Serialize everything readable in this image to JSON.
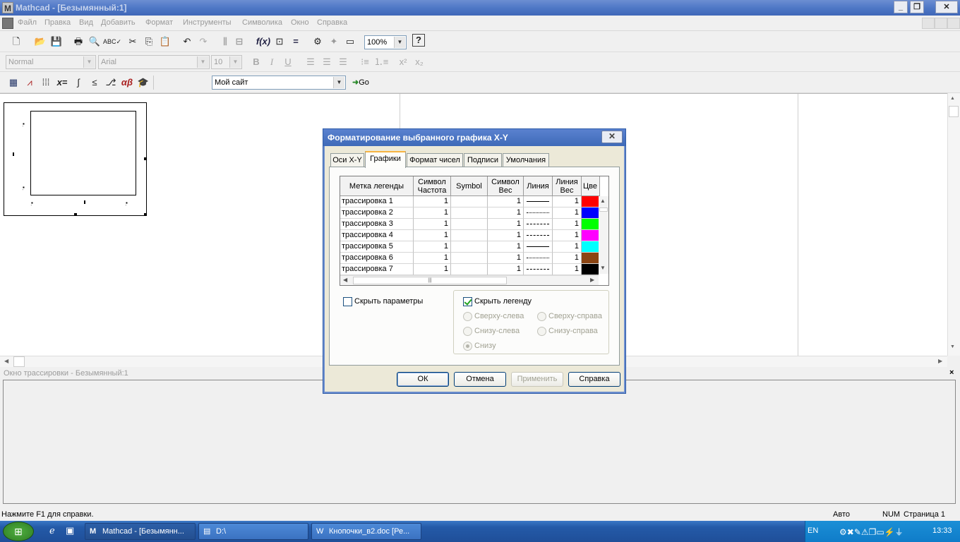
{
  "window": {
    "title": "Mathcad - [Безымянный:1]",
    "app_icon": "mathcad-icon"
  },
  "menu": [
    "Файл",
    "Правка",
    "Вид",
    "Добавить",
    "Формат",
    "Инструменты",
    "Символика",
    "Окно",
    "Справка"
  ],
  "toolbar": {
    "zoom": "100%",
    "style": "Normal",
    "font": "Arial",
    "font_size": "10",
    "site": "Мой сайт",
    "go_label": "Go"
  },
  "formatbar": {
    "bold": "B",
    "italic": "I",
    "underline": "U",
    "superscript": "x²",
    "subscript": "x₂"
  },
  "trace_window": {
    "title": "Окно трассировки - Безымянный:1"
  },
  "status": {
    "hint": "Нажмите F1 для справки.",
    "mode": "Авто",
    "num": "NUM",
    "page": "Страница 1"
  },
  "taskbar": {
    "tasks": [
      "Mathcad - [Безымянн...",
      "D:\\",
      "Кнопочки_в2.doc [Ре..."
    ],
    "lang": "EN",
    "clock": "13:33"
  },
  "dialog": {
    "title": "Форматирование выбранного графика X-Y",
    "tabs": [
      "Оси X-Y",
      "Графики",
      "Формат чисел",
      "Подписи",
      "Умолчания"
    ],
    "selected_tab": "Графики",
    "columns": [
      "Метка легенды",
      "Символ Частота",
      "Symbol",
      "Символ Вес",
      "Линия",
      "Линия Вес",
      "Цве"
    ],
    "rows": [
      {
        "label": "трассировка 1",
        "freq": "1",
        "symbol": "",
        "sym_weight": "1",
        "line": "solid",
        "line_weight": "1",
        "color": "#ff0000"
      },
      {
        "label": "трассировка 2",
        "freq": "1",
        "symbol": "",
        "sym_weight": "1",
        "line": "dotted",
        "line_weight": "1",
        "color": "#0000ff"
      },
      {
        "label": "трассировка 3",
        "freq": "1",
        "symbol": "",
        "sym_weight": "1",
        "line": "dashed",
        "line_weight": "1",
        "color": "#00ff00"
      },
      {
        "label": "трассировка 4",
        "freq": "1",
        "symbol": "",
        "sym_weight": "1",
        "line": "dashdot",
        "line_weight": "1",
        "color": "#ff00ff"
      },
      {
        "label": "трассировка 5",
        "freq": "1",
        "symbol": "",
        "sym_weight": "1",
        "line": "solid",
        "line_weight": "1",
        "color": "#00ffff"
      },
      {
        "label": "трассировка 6",
        "freq": "1",
        "symbol": "",
        "sym_weight": "1",
        "line": "dotted",
        "line_weight": "1",
        "color": "#8b4513"
      },
      {
        "label": "трассировка 7",
        "freq": "1",
        "symbol": "",
        "sym_weight": "1",
        "line": "dashed",
        "line_weight": "1",
        "color": "#000000"
      }
    ],
    "hide_params": {
      "label": "Скрыть параметры",
      "checked": false
    },
    "hide_legend": {
      "label": "Скрыть легенду",
      "checked": true
    },
    "legend_positions": {
      "top_left": "Сверху-слева",
      "top_right": "Сверху-справа",
      "bottom_left": "Снизу-слева",
      "bottom_right": "Снизу-справа",
      "below": "Снизу",
      "selected": "Снизу"
    },
    "buttons": {
      "ok": "ОК",
      "cancel": "Отмена",
      "apply": "Применить",
      "help": "Справка"
    }
  }
}
